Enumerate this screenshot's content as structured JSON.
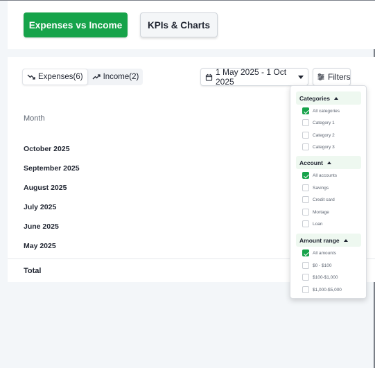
{
  "tabs": {
    "expenses_vs_income": "Expenses vs Income",
    "kpis_charts": "KPIs & Charts",
    "accent_color": "#16a34a"
  },
  "toggles": {
    "expenses": "Expenses(6)",
    "income": "Income(2)"
  },
  "date_range": {
    "label": "1 May 2025 - 1 Oct 2025"
  },
  "filters_button": {
    "label": "Filters"
  },
  "table": {
    "column_header": "Month",
    "rows": [
      "October  2025",
      "September 2025",
      "August 2025",
      "July 2025",
      "June 2025",
      "May 2025"
    ],
    "total_label": "Total"
  },
  "filter_panel": {
    "categories": {
      "title": "Categories",
      "options": [
        {
          "label": "All categories",
          "checked": true
        },
        {
          "label": "Category 1",
          "checked": false
        },
        {
          "label": "Category 2",
          "checked": false
        },
        {
          "label": "Category 3",
          "checked": false
        }
      ]
    },
    "account": {
      "title": "Account",
      "options": [
        {
          "label": "All accounts",
          "checked": true
        },
        {
          "label": "Savings",
          "checked": false
        },
        {
          "label": "Credit card",
          "checked": false
        },
        {
          "label": "Mortage",
          "checked": false
        },
        {
          "label": "Loan",
          "checked": false
        }
      ]
    },
    "amount_range": {
      "title": "Amount range",
      "options": [
        {
          "label": "All amounts",
          "checked": true
        },
        {
          "label": "$0 - $100",
          "checked": false
        },
        {
          "label": "$100-$1,000",
          "checked": false
        },
        {
          "label": "$1,000-$5,000",
          "checked": false
        }
      ]
    }
  }
}
